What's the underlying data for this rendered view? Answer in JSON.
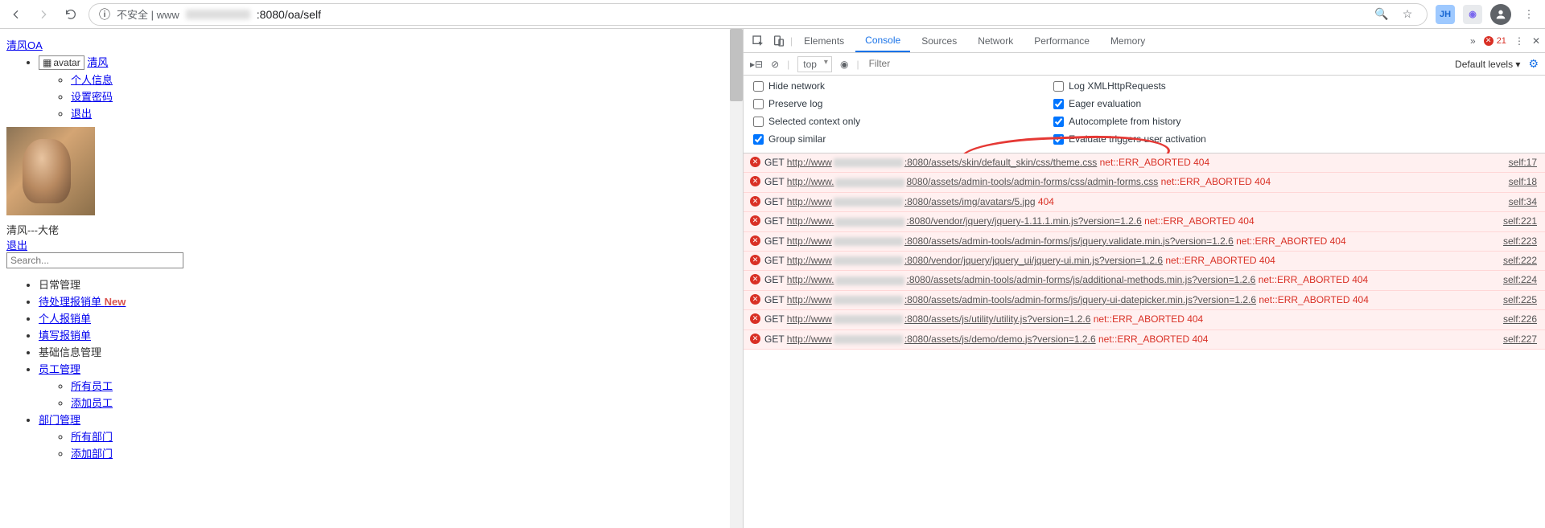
{
  "browser": {
    "address_prefix": "不安全 | www",
    "address_suffix": ":8080/oa/self",
    "search_hint": "",
    "badge_jh": "JH"
  },
  "page": {
    "brand": "清风OA",
    "avatar_alt": "avatar",
    "avatar_user": "清风",
    "menu": {
      "profile": "个人信息",
      "password": "设置密码",
      "logout": "退出"
    },
    "user_label": "清风---大佬",
    "exit": "退出",
    "search_placeholder": "Search...",
    "nav": {
      "daily": "日常管理",
      "pending": "待处理报销单",
      "pending_badge": "New",
      "personal_reimb": "个人报销单",
      "fill_reimb": "填写报销单",
      "basic_info": "基础信息管理",
      "emp_mgmt": "员工管理",
      "all_emp": "所有员工",
      "add_emp": "添加员工",
      "dept_mgmt": "部门管理",
      "all_dept": "所有部门",
      "add_dept": "添加部门"
    }
  },
  "devtools": {
    "tabs": {
      "elements": "Elements",
      "console": "Console",
      "sources": "Sources",
      "network": "Network",
      "performance": "Performance",
      "memory": "Memory"
    },
    "error_count": "21",
    "context": "top",
    "filter_placeholder": "Filter",
    "levels": "Default levels ▾",
    "opts": {
      "hide_network": "Hide network",
      "preserve_log": "Preserve log",
      "selected_ctx": "Selected context only",
      "group_similar": "Group similar",
      "log_xhr": "Log XMLHttpRequests",
      "eager_eval": "Eager evaluation",
      "autocomplete": "Autocomplete from history",
      "eval_trigger": "Evaluate triggers user activation"
    },
    "rows": [
      {
        "method": "GET",
        "pre": "http://www",
        "post": ":8080/assets/skin/default_skin/css/theme.css",
        "status": "",
        "net": "net::ERR_ABORTED 404",
        "src": "self:17"
      },
      {
        "method": "GET",
        "pre": "http://www.",
        "post": "8080/assets/admin-tools/admin-forms/css/admin-forms.css",
        "status": "",
        "net": "net::ERR_ABORTED 404",
        "src": "self:18"
      },
      {
        "method": "GET",
        "pre": "http://www",
        "post": ":8080/assets/img/avatars/5.jpg",
        "status": "404",
        "net": "",
        "src": "self:34"
      },
      {
        "method": "GET",
        "pre": "http://www.",
        "post": ":8080/vendor/jquery/jquery-1.11.1.min.js?version=1.2.6",
        "status": "",
        "net": "net::ERR_ABORTED 404",
        "src": "self:221"
      },
      {
        "method": "GET",
        "pre": "http://www",
        "post": ":8080/assets/admin-tools/admin-forms/js/jquery.validate.min.js?version=1.2.6",
        "status": "",
        "net": "net::ERR_ABORTED 404",
        "src": "self:223"
      },
      {
        "method": "GET",
        "pre": "http://www",
        "post": ":8080/vendor/jquery/jquery_ui/jquery-ui.min.js?version=1.2.6",
        "status": "",
        "net": "net::ERR_ABORTED 404",
        "src": "self:222"
      },
      {
        "method": "GET",
        "pre": "http://www.",
        "post": ":8080/assets/admin-tools/admin-forms/js/additional-methods.min.js?version=1.2.6",
        "status": "",
        "net": "net::ERR_ABORTED 404",
        "src": "self:224"
      },
      {
        "method": "GET",
        "pre": "http://www",
        "post": ":8080/assets/admin-tools/admin-forms/js/jquery-ui-datepicker.min.js?version=1.2.6",
        "status": "",
        "net": "net::ERR_ABORTED 404",
        "src": "self:225"
      },
      {
        "method": "GET",
        "pre": "http://www",
        "post": ":8080/assets/js/utility/utility.js?version=1.2.6",
        "status": "",
        "net": "net::ERR_ABORTED 404",
        "src": "self:226"
      },
      {
        "method": "GET",
        "pre": "http://www",
        "post": ":8080/assets/js/demo/demo.js?version=1.2.6",
        "status": "",
        "net": "net::ERR_ABORTED 404",
        "src": "self:227"
      }
    ]
  }
}
